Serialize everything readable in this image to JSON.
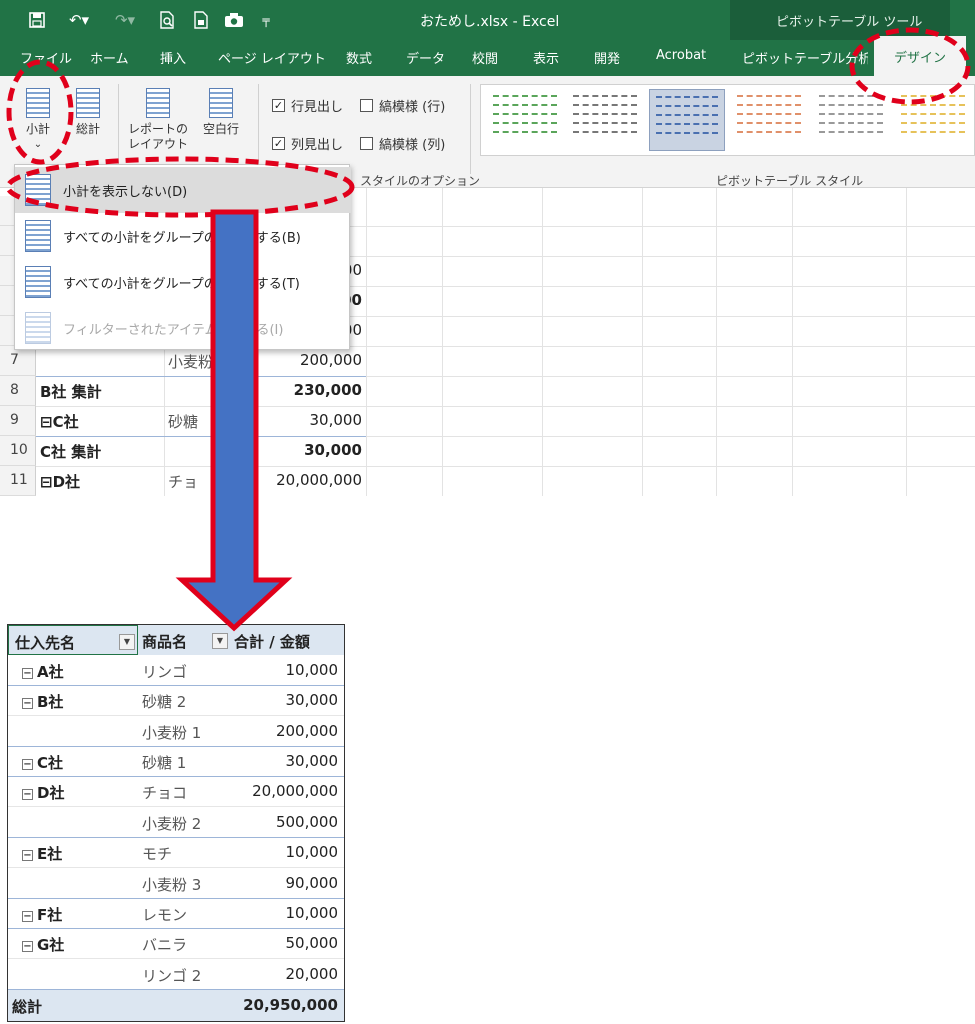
{
  "titlebar": {
    "title": "おためし.xlsx  -  Excel",
    "context_tool": "ピボットテーブル ツール"
  },
  "tabs": [
    "ファイル",
    "ホーム",
    "挿入",
    "ページ レイアウト",
    "数式",
    "データ",
    "校閲",
    "表示",
    "開発",
    "Acrobat",
    "ピボットテーブル分析",
    "デザイン"
  ],
  "ribbon": {
    "subtotal_label": "小計",
    "grandtotal_label": "総計",
    "report_layout_label": "レポートのレイアウト",
    "blank_rows_label": "空白行",
    "options": {
      "row_headers": "行見出し",
      "col_headers": "列見出し",
      "banded_rows": "縞模様 (行)",
      "banded_cols": "縞模様 (列)",
      "row_headers_checked": true,
      "col_headers_checked": true,
      "banded_rows_checked": false,
      "banded_cols_checked": false
    },
    "group_style_options": "スタイルのオプション",
    "group_pivot_styles": "ピボットテーブル スタイル"
  },
  "subtotal_menu": [
    {
      "label": "小計を表示しない(D)",
      "state": "highlighted"
    },
    {
      "label": "すべての小計をグループの…表示する(B)",
      "state": "normal"
    },
    {
      "label": "すべての小計をグループの…表示する(T)",
      "state": "normal"
    },
    {
      "label": "フィルターされたアイテム…含める(I)",
      "state": "disabled"
    }
  ],
  "sheet_rows": [
    {
      "row": "",
      "a": "",
      "b": "",
      "c": "",
      "a_bold": false,
      "c_bold": false
    },
    {
      "row": "",
      "a": "",
      "b": "",
      "c": "",
      "a_bold": false,
      "c_bold": false
    },
    {
      "row": "",
      "a": "",
      "b": "",
      "c": ",000",
      "a_bold": false,
      "c_bold": false
    },
    {
      "row": "",
      "a": "",
      "b": "",
      "c": "00",
      "a_bold": false,
      "c_bold": true
    },
    {
      "row": "",
      "a": "",
      "b": "",
      "c": ",000",
      "a_bold": false,
      "c_bold": false
    },
    {
      "row": "7",
      "a": "",
      "b": "小麦粉",
      "c": "200,000",
      "a_bold": false,
      "c_bold": false
    },
    {
      "row": "8",
      "a": "B社 集計",
      "b": "",
      "c": "230,000",
      "a_bold": true,
      "c_bold": true
    },
    {
      "row": "9",
      "a": "⊟C社",
      "b": "砂糖",
      "c": "30,000",
      "a_bold": true,
      "c_bold": false
    },
    {
      "row": "10",
      "a": "C社 集計",
      "b": "",
      "c": "30,000",
      "a_bold": true,
      "c_bold": true
    },
    {
      "row": "11",
      "a": "⊟D社",
      "b": "チョ",
      "c": "20,000,000",
      "a_bold": true,
      "c_bold": false
    }
  ],
  "result_table": {
    "headers": [
      "仕入先名",
      "商品名",
      "合計 / 金額"
    ],
    "rows": [
      {
        "supplier": "A社",
        "product": "リンゴ",
        "amount": "10,000"
      },
      {
        "supplier": "B社",
        "product": "砂糖 2",
        "amount": "30,000"
      },
      {
        "supplier": "",
        "product": "小麦粉 1",
        "amount": "200,000"
      },
      {
        "supplier": "C社",
        "product": "砂糖 1",
        "amount": "30,000"
      },
      {
        "supplier": "D社",
        "product": "チョコ",
        "amount": "20,000,000"
      },
      {
        "supplier": "",
        "product": "小麦粉 2",
        "amount": "500,000"
      },
      {
        "supplier": "E社",
        "product": "モチ",
        "amount": "10,000"
      },
      {
        "supplier": "",
        "product": "小麦粉 3",
        "amount": "90,000"
      },
      {
        "supplier": "F社",
        "product": "レモン",
        "amount": "10,000"
      },
      {
        "supplier": "G社",
        "product": "バニラ",
        "amount": "50,000"
      },
      {
        "supplier": "",
        "product": "リンゴ 2",
        "amount": "20,000"
      }
    ],
    "total_label": "総計",
    "total_amount": "20,950,000"
  },
  "colors": {
    "excel_green": "#217346",
    "annotation_red": "#e0001b",
    "arrow_blue": "#4472c4",
    "header_band": "#dce6f1"
  }
}
